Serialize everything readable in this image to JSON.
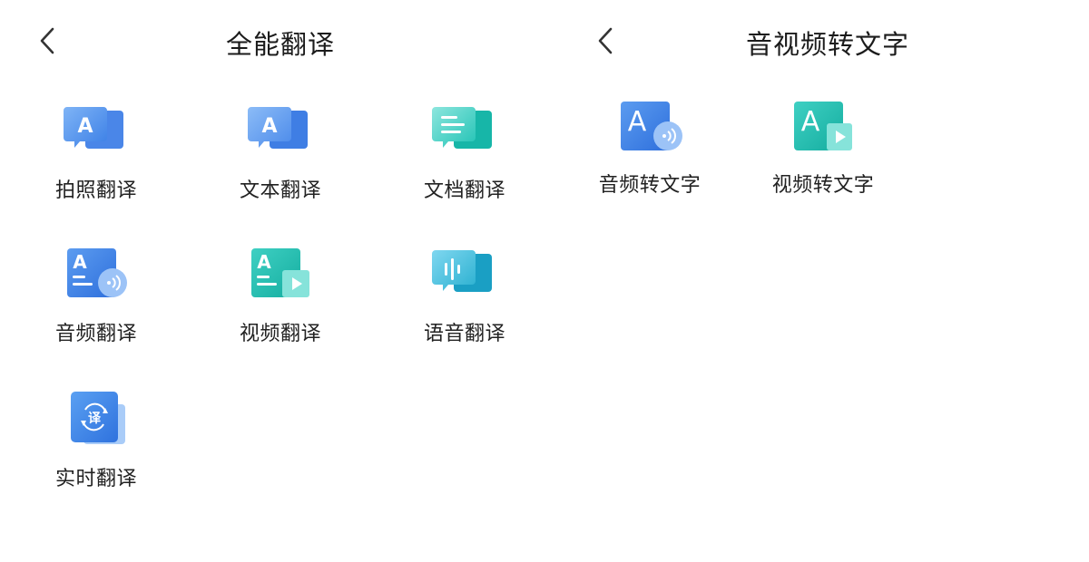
{
  "left_panel": {
    "title": "全能翻译",
    "items": [
      {
        "label": "拍照翻译",
        "icon": "photo-translate-icon"
      },
      {
        "label": "文本翻译",
        "icon": "text-translate-icon"
      },
      {
        "label": "文档翻译",
        "icon": "document-translate-icon"
      },
      {
        "label": "音频翻译",
        "icon": "audio-translate-icon"
      },
      {
        "label": "视频翻译",
        "icon": "video-translate-icon"
      },
      {
        "label": "语音翻译",
        "icon": "voice-translate-icon"
      },
      {
        "label": "实时翻译",
        "icon": "realtime-translate-icon"
      }
    ]
  },
  "right_panel": {
    "title": "音视频转文字",
    "items": [
      {
        "label": "音频转文字",
        "icon": "audio-to-text-icon"
      },
      {
        "label": "视频转文字",
        "icon": "video-to-text-icon"
      }
    ]
  },
  "colors": {
    "blue": "#3b82e8",
    "light_blue": "#8cb9f5",
    "teal": "#1cc1b3",
    "light_teal": "#7fe0d8",
    "title_text": "#1b1b1b",
    "label_text": "#222222"
  }
}
